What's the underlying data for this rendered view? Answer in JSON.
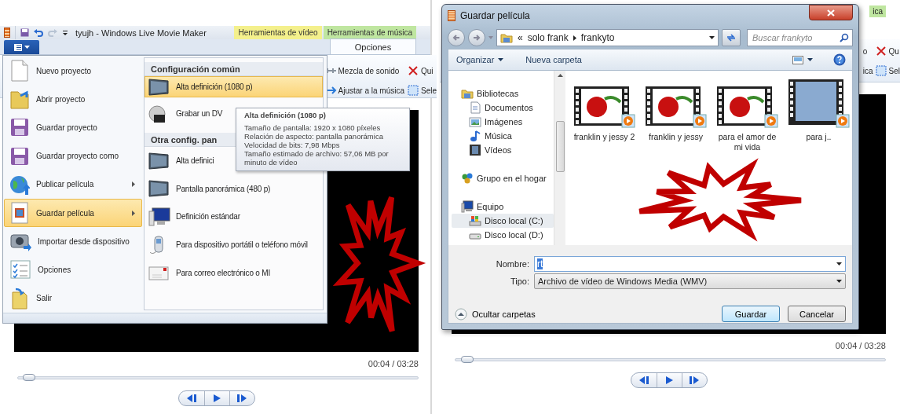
{
  "left": {
    "title_bar": {
      "title": "tyujh - Windows Live Movie Maker",
      "context_tabs": [
        {
          "label": "Herramientas de vídeo",
          "color": "#f4f08c"
        },
        {
          "label": "Herramientas de música",
          "color": "#bfe6a0"
        }
      ]
    },
    "ribbon_tab": "Opciones",
    "ribbon_commands": [
      {
        "label": "Mezcla de sonido",
        "kind": "mix"
      },
      {
        "label": "Qui",
        "kind": "remove"
      },
      {
        "label": "Ajustar a la música",
        "kind": "fit"
      },
      {
        "label": "Sele",
        "kind": "select"
      }
    ],
    "file_menu": {
      "items": [
        {
          "label": "Nuevo proyecto",
          "kind": "document",
          "submenu": false,
          "selected": false
        },
        {
          "label": "Abrir proyecto",
          "kind": "folder",
          "submenu": false,
          "selected": false
        },
        {
          "label": "Guardar proyecto",
          "kind": "floppy",
          "submenu": false,
          "selected": false
        },
        {
          "label": "Guardar proyecto como",
          "kind": "floppy",
          "submenu": false,
          "selected": false
        },
        {
          "label": "Publicar película",
          "kind": "globe",
          "submenu": true,
          "selected": false
        },
        {
          "label": "Guardar película",
          "kind": "film",
          "submenu": true,
          "selected": true
        },
        {
          "label": "Importar desde dispositivo",
          "kind": "camera",
          "submenu": false,
          "selected": false
        },
        {
          "label": "Opciones",
          "kind": "checklist",
          "submenu": false,
          "selected": false
        },
        {
          "label": "Salir",
          "kind": "exit",
          "submenu": false,
          "selected": false
        }
      ],
      "submenu": {
        "sections": [
          {
            "header": "Configuración común",
            "items": [
              {
                "label": "Alta definición (1080 p)",
                "kind": "monitor",
                "selected": true
              },
              {
                "label": "Grabar un DV",
                "kind": "dvd",
                "selected": false
              }
            ]
          },
          {
            "header": "Otra config. pan",
            "items": [
              {
                "label": "Alta definici",
                "kind": "monitor",
                "selected": false
              },
              {
                "label": "Pantalla panorámica (480 p)",
                "kind": "monitor",
                "selected": false
              },
              {
                "label": "Definición estándar",
                "kind": "pc",
                "selected": false
              },
              {
                "label": "Para dispositivo portátil o teléfono móvil",
                "kind": "phone",
                "selected": false
              },
              {
                "label": "Para correo electrónico o MI",
                "kind": "mail",
                "selected": false
              }
            ]
          }
        ]
      },
      "tooltip": {
        "title": "Alta definición (1080 p)",
        "lines": [
          "Tamaño de pantalla: 1920 x 1080 píxeles",
          "Relación de aspecto: pantalla panorámica",
          "Velocidad de bits: 7,98 Mbps",
          "Tamaño estimado de archivo: 57,06 MB por minuto de vídeo"
        ]
      }
    },
    "player": {
      "time": "00:04 / 03:28",
      "level": 0.02
    }
  },
  "right": {
    "background": {
      "context_tab": "ica",
      "ribbon_commands": [
        {
          "label": "o",
          "kind": "none"
        },
        {
          "label": "Qu",
          "kind": "remove"
        },
        {
          "label": "ica",
          "kind": "none"
        },
        {
          "label": "Sel",
          "kind": "select"
        }
      ]
    },
    "player": {
      "time": "00:04 / 03:28",
      "level": 0.02
    },
    "dialog": {
      "title": "Guardar película",
      "address": {
        "overflow": "«",
        "segments": [
          "solo frank",
          "frankyto"
        ]
      },
      "search": {
        "placeholder": "Buscar frankyto"
      },
      "toolbar": {
        "organize": "Organizar",
        "new_folder": "Nueva carpeta"
      },
      "nav": [
        {
          "label": "Bibliotecas",
          "kind": "library",
          "selected": false,
          "children": [
            {
              "label": "Documentos",
              "kind": "docs",
              "selected": false
            },
            {
              "label": "Imágenes",
              "kind": "images",
              "selected": false
            },
            {
              "label": "Música",
              "kind": "music",
              "selected": false
            },
            {
              "label": "Vídeos",
              "kind": "videos",
              "selected": false
            }
          ]
        },
        {
          "label": "Grupo en el hogar",
          "kind": "homegroup",
          "selected": false
        },
        {
          "label": "Equipo",
          "kind": "computer",
          "selected": false,
          "children": [
            {
              "label": "Disco local (C:)",
              "kind": "disk",
              "selected": true
            },
            {
              "label": "Disco local (D:)",
              "kind": "drive",
              "selected": false
            }
          ]
        }
      ],
      "files": [
        {
          "name": "franklin y jessy 2",
          "kind": "rose"
        },
        {
          "name": "franklin y jessy",
          "kind": "rose"
        },
        {
          "name": "para el amor de mi vida",
          "kind": "rose"
        },
        {
          "name": "para j..",
          "kind": "text"
        }
      ],
      "filename": {
        "label": "Nombre:",
        "value": "rt"
      },
      "filetype": {
        "label": "Tipo:",
        "value": "Archivo de vídeo de Windows Media (WMV)"
      },
      "hide_folders": "Ocultar carpetas",
      "buttons": [
        {
          "label": "Guardar",
          "default": true
        },
        {
          "label": "Cancelar",
          "default": false
        }
      ]
    }
  }
}
